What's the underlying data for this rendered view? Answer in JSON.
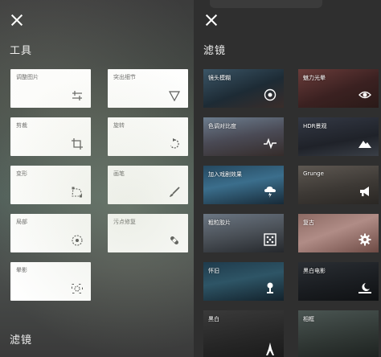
{
  "left": {
    "section_title": "工具",
    "bottom_title": "滤镜",
    "tools": [
      {
        "label": "调整图片",
        "icon": "sliders-icon"
      },
      {
        "label": "突出细节",
        "icon": "triangle-icon"
      },
      {
        "label": "剪裁",
        "icon": "crop-icon"
      },
      {
        "label": "旋转",
        "icon": "rotate-icon"
      },
      {
        "label": "变形",
        "icon": "perspective-icon"
      },
      {
        "label": "画笔",
        "icon": "brush-icon"
      },
      {
        "label": "局部",
        "icon": "target-icon"
      },
      {
        "label": "污点修复",
        "icon": "bandage-icon"
      },
      {
        "label": "晕影",
        "icon": "vignette-icon"
      }
    ]
  },
  "right": {
    "section_title": "滤镜",
    "filters": [
      {
        "label": "镜头模糊",
        "icon": "lens-icon"
      },
      {
        "label": "魅力光晕",
        "icon": "eye-icon"
      },
      {
        "label": "色调对比度",
        "icon": "pulse-icon"
      },
      {
        "label": "HDR景观",
        "icon": "mountain-icon"
      },
      {
        "label": "加入戏剧效果",
        "icon": "cloud-lightning-icon"
      },
      {
        "label": "Grunge",
        "icon": "megaphone-icon"
      },
      {
        "label": "粗粒胶片",
        "icon": "film-grain-icon"
      },
      {
        "label": "复古",
        "icon": "gear-icon"
      },
      {
        "label": "怀旧",
        "icon": "scroll-icon"
      },
      {
        "label": "黑白电影",
        "icon": "moon-city-icon"
      },
      {
        "label": "黑白",
        "icon": "tower-icon"
      },
      {
        "label": "相框",
        "icon": "frame-icon"
      }
    ]
  }
}
